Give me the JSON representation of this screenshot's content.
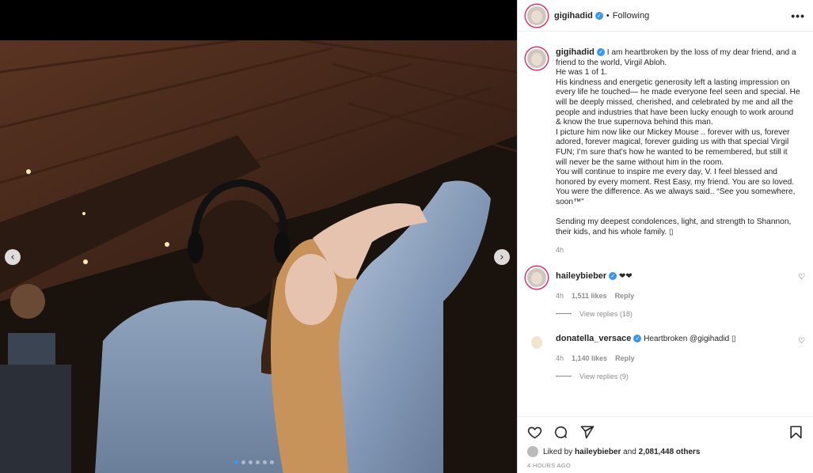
{
  "post": {
    "username": "gigihadid",
    "following_label": "Following",
    "more_label": "•••",
    "caption_lines": [
      "I am heartbroken by the loss of my dear friend, and a",
      "friend to the world, Virgil Abloh.",
      "He was 1 of 1.",
      "His kindness and energetic generosity left a lasting impression on",
      "every life he touched— he made everyone feel seen and special. He",
      "will be deeply missed, cherished, and celebrated by me and all the",
      "people and industries that have been lucky enough to work around",
      "& know the true supernova behind this man.",
      "I picture him now like our Mickey Mouse .. forever with us, forever",
      "adored, forever magical, forever guiding us with that special Virgil",
      "FUN; I’m sure that’s how he wanted to be remembered, but still it",
      "will never be the same without him in the room.",
      "You will continue to inspire me every day, V. I feel blessed and",
      "honored by every moment. Rest Easy, my friend. You are so loved.",
      "You were the difference. As we always said.. “See you somewhere,",
      "soon™”",
      "",
      "Sending my deepest condolences, light, and strength to Shannon,",
      "their kids, and his whole family. ▯"
    ],
    "caption_time": "4h",
    "likes_prefix": "Liked by",
    "likes_user": "haileybieber",
    "likes_joiner": "and",
    "likes_count": "2,081,448 others",
    "timestamp": "4 HOURS AGO"
  },
  "comments": [
    {
      "username": "haileybieber",
      "text": "❤❤",
      "time": "4h",
      "likes": "1,511 likes",
      "reply": "Reply",
      "view_replies": "View replies (18)"
    },
    {
      "username": "donatella_versace",
      "text": "Heartbroken @gigihadid ▯",
      "time": "4h",
      "likes": "1,140 likes",
      "reply": "Reply",
      "view_replies": "View replies (9)"
    }
  ],
  "media": {
    "prev_label": "‹",
    "next_label": "›",
    "slide_count": 6,
    "active_slide": 1
  },
  "colors": {
    "accent": "#3897f0",
    "story_ring": "#e1306c",
    "text": "#262626",
    "muted": "#8e8e8e"
  },
  "icons": {
    "like": "heart-icon",
    "comment": "comment-icon",
    "share": "paper-plane-icon",
    "save": "bookmark-icon"
  }
}
